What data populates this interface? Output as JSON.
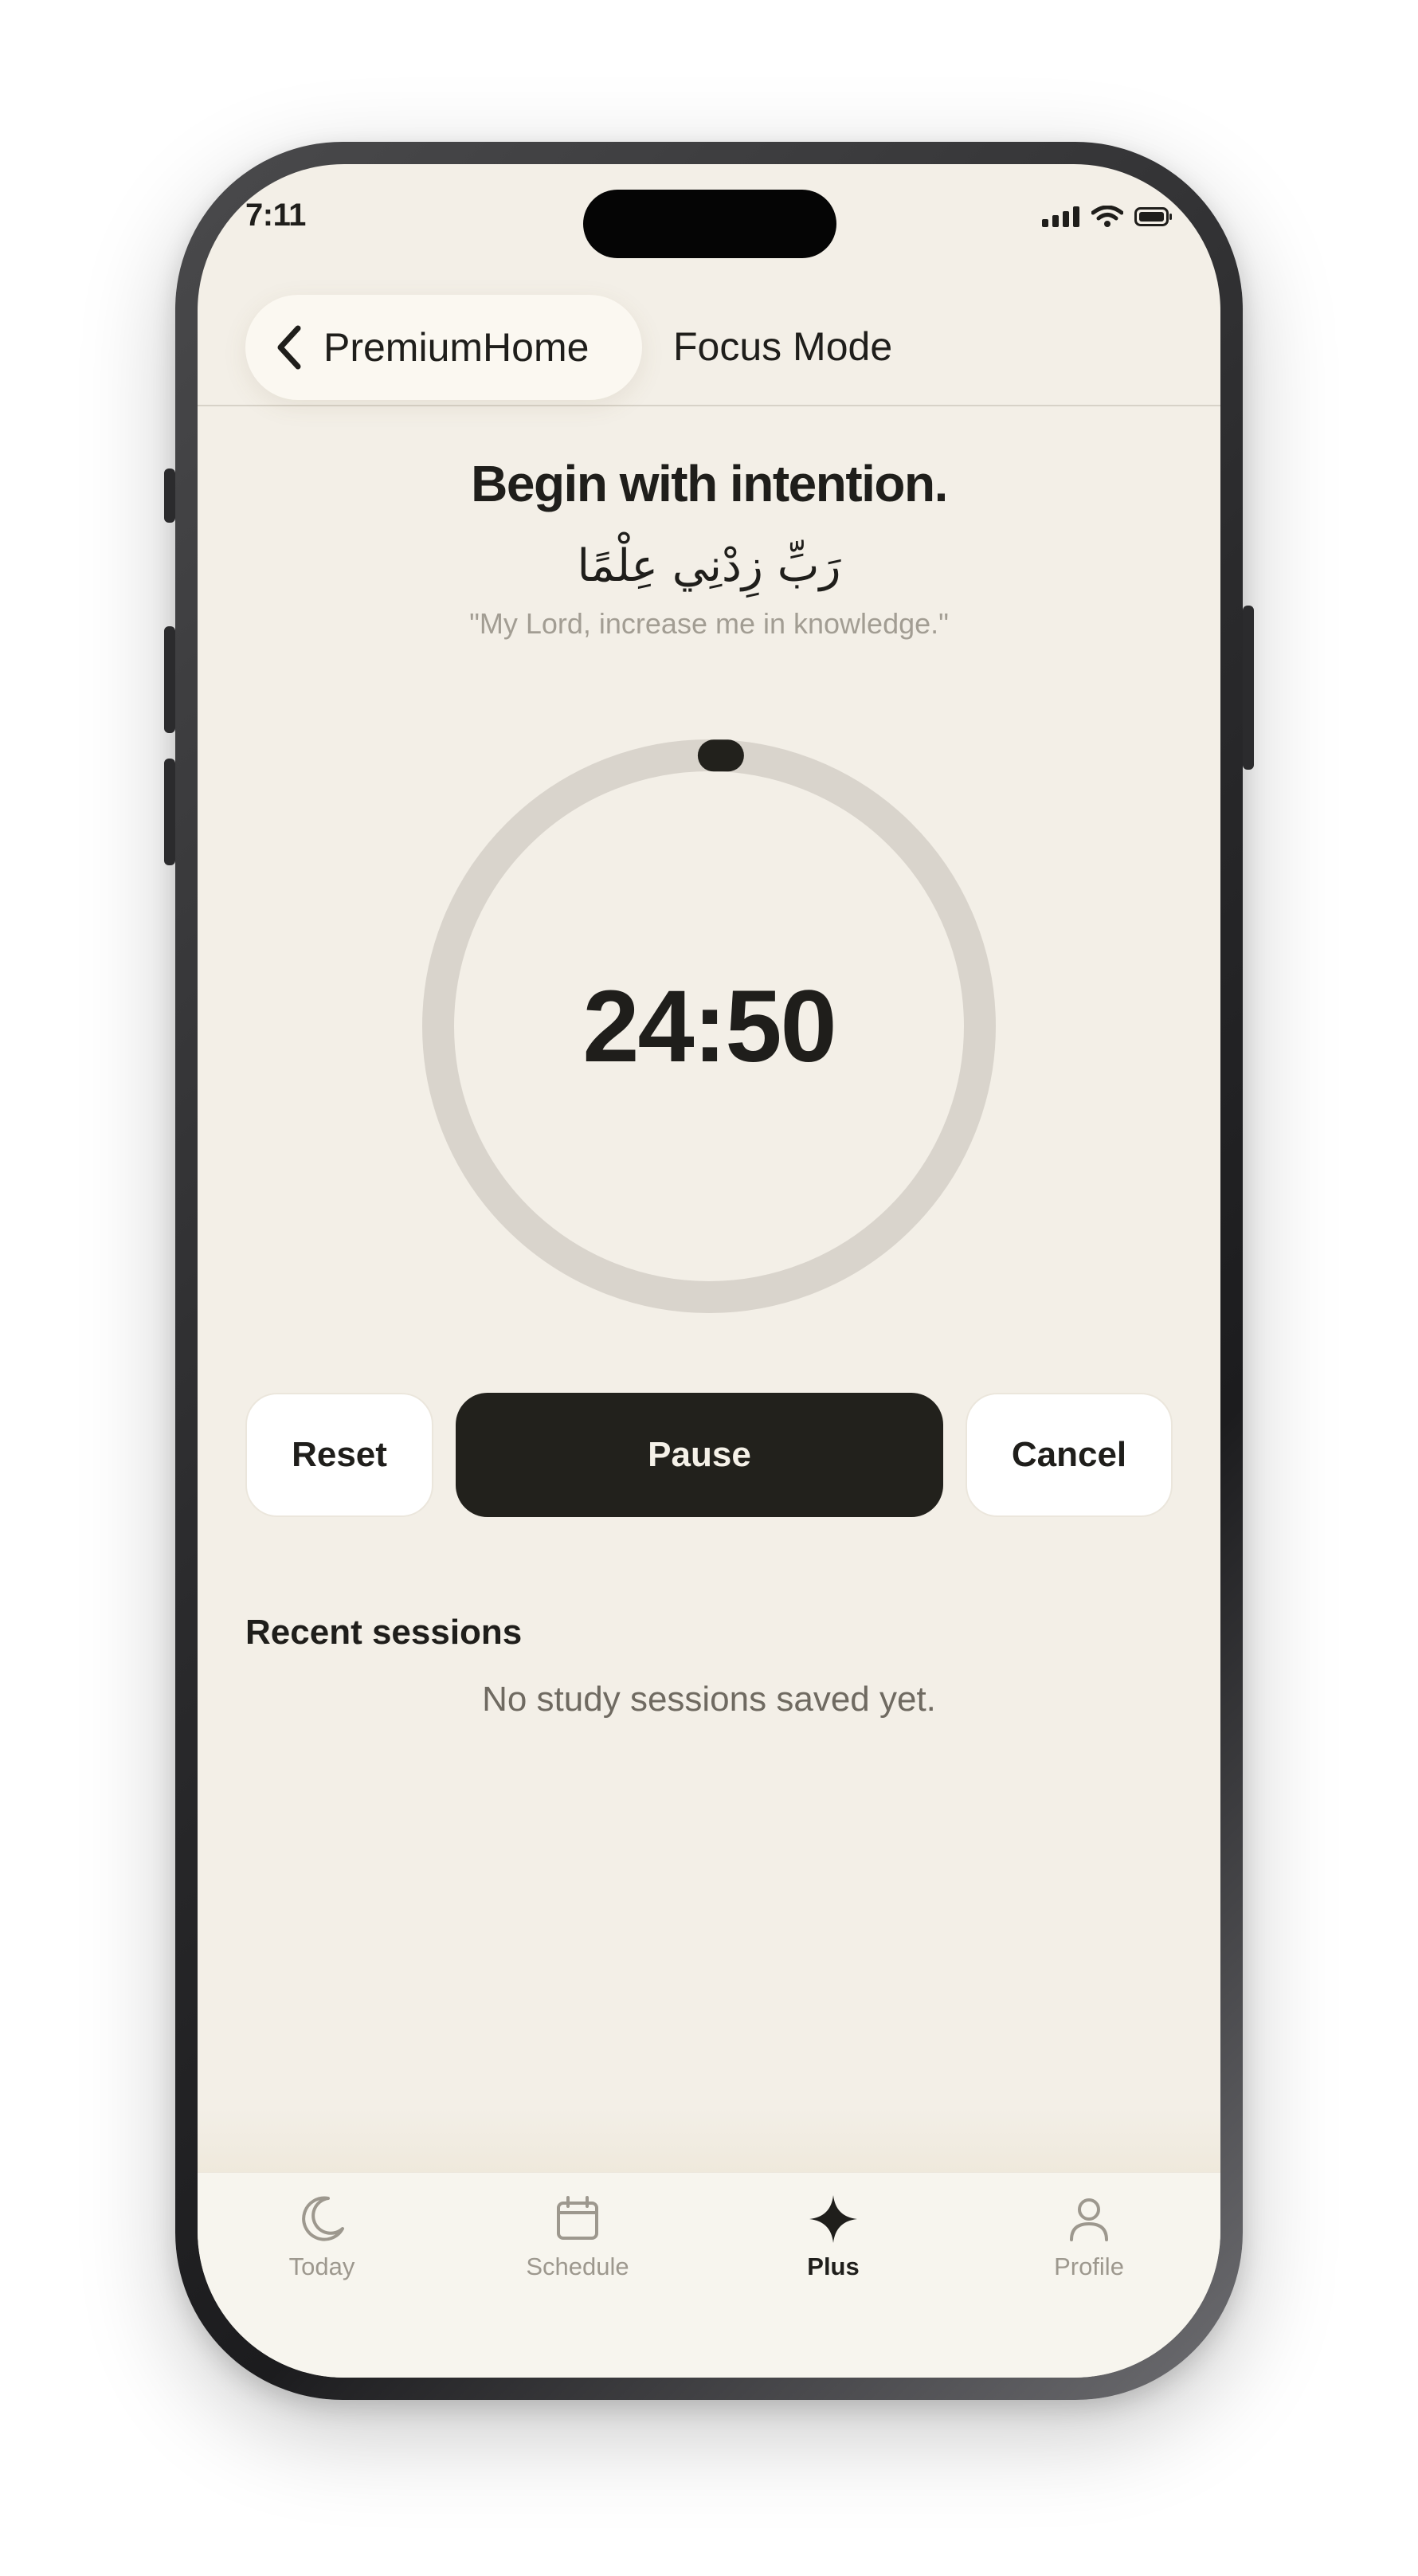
{
  "status_bar": {
    "time": "7:11",
    "icons": [
      "cellular-signal-icon",
      "wifi-icon",
      "battery-icon"
    ]
  },
  "header": {
    "back_label": "PremiumHome",
    "title": "Focus Mode"
  },
  "intro": {
    "heading": "Begin with intention.",
    "arabic": "رَبِّ زِدْنِي عِلْمًا",
    "translation": "\"My Lord, increase me in knowledge.\""
  },
  "timer": {
    "remaining": "24:50",
    "progress_fraction": 0.007,
    "track_color": "#d9d4cc",
    "handle_color": "#22211c"
  },
  "controls": {
    "reset_label": "Reset",
    "pause_label": "Pause",
    "cancel_label": "Cancel"
  },
  "recent": {
    "title": "Recent sessions",
    "empty_message": "No study sessions saved yet."
  },
  "tabs": [
    {
      "label": "Today",
      "icon": "moon-icon",
      "active": false
    },
    {
      "label": "Schedule",
      "icon": "calendar-icon",
      "active": false
    },
    {
      "label": "Plus",
      "icon": "sparkle-icon",
      "active": true
    },
    {
      "label": "Profile",
      "icon": "person-icon",
      "active": false
    }
  ],
  "colors": {
    "background": "#f3efe7",
    "text_primary": "#1f1e1b",
    "text_secondary": "#a29d93",
    "accent": "#22211c"
  }
}
